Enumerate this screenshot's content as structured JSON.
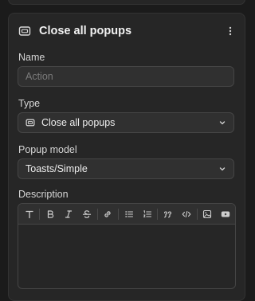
{
  "header": {
    "title": "Close all popups",
    "icon": "popup-icon",
    "menu_icon": "more-vertical-icon"
  },
  "fields": {
    "name": {
      "label": "Name",
      "value": "",
      "placeholder": "Action"
    },
    "type": {
      "label": "Type",
      "selected": "Close all popups",
      "icon": "popup-icon"
    },
    "popup_model": {
      "label": "Popup model",
      "selected": "Toasts/Simple"
    },
    "description": {
      "label": "Description",
      "value": ""
    }
  },
  "toolbar": {
    "buttons": [
      {
        "name": "text-style",
        "icon": "text-icon"
      },
      {
        "name": "bold",
        "icon": "bold-icon"
      },
      {
        "name": "italic",
        "icon": "italic-icon"
      },
      {
        "name": "strikethrough",
        "icon": "strikethrough-icon"
      },
      {
        "name": "link",
        "icon": "link-icon"
      },
      {
        "name": "bullet-list",
        "icon": "bullet-list-icon"
      },
      {
        "name": "numbered-list",
        "icon": "numbered-list-icon"
      },
      {
        "name": "quote",
        "icon": "quote-icon"
      },
      {
        "name": "code",
        "icon": "code-icon"
      },
      {
        "name": "image",
        "icon": "image-icon"
      },
      {
        "name": "video",
        "icon": "video-icon"
      }
    ]
  },
  "colors": {
    "background": "#1b1b1b",
    "panel": "#262626",
    "field": "#303030",
    "border": "#454545",
    "text": "#ededed",
    "placeholder": "#7b7b7b"
  }
}
